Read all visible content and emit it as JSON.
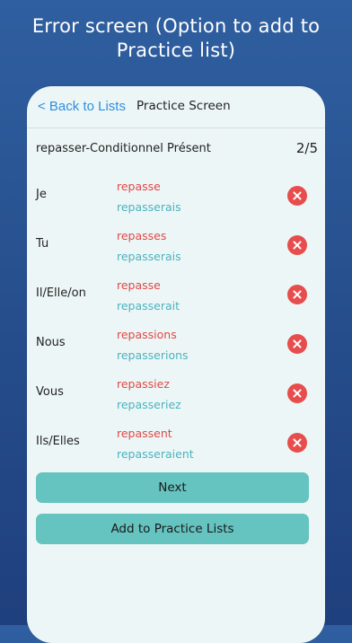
{
  "headline": {
    "line1": "Error screen (Option to add to",
    "line2": "Practice list)"
  },
  "navbar": {
    "back_label": "< Back to Lists",
    "title": "Practice Screen"
  },
  "verb": {
    "title": "repasser-Conditionnel Présent",
    "progress": "2/5"
  },
  "rows": [
    {
      "pronoun": "Je",
      "wrong": "repasse",
      "correct": "repasserais"
    },
    {
      "pronoun": "Tu",
      "wrong": "repasses",
      "correct": "repasserais"
    },
    {
      "pronoun": "Il/Elle/on",
      "wrong": "repasse",
      "correct": "repasserait"
    },
    {
      "pronoun": "Nous",
      "wrong": "repassions",
      "correct": "repasserions"
    },
    {
      "pronoun": "Vous",
      "wrong": "repassiez",
      "correct": "repasseriez"
    },
    {
      "pronoun": "Ils/Elles",
      "wrong": "repassent",
      "correct": "repasseraient"
    }
  ],
  "buttons": {
    "next_label": "Next",
    "add_label": "Add to Practice Lists"
  },
  "colors": {
    "wrong": "#e04848",
    "correct": "#4ab3bd",
    "button": "#65c3c0",
    "error_icon": "#e84d4d"
  },
  "icons": {
    "row_status": "close-circle-icon"
  }
}
